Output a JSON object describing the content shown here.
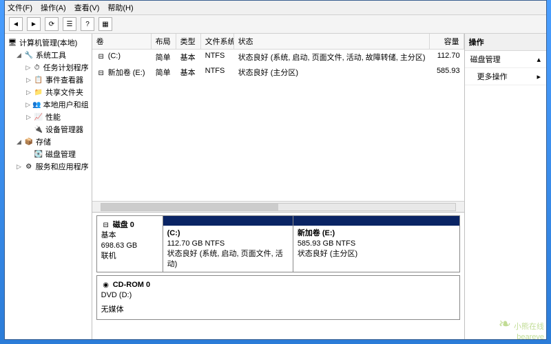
{
  "menu": {
    "file": "文件(F)",
    "action": "操作(A)",
    "view": "查看(V)",
    "help": "帮助(H)"
  },
  "tree": {
    "root": "计算机管理(本地)",
    "system_tools": "系统工具",
    "task_scheduler": "任务计划程序",
    "event_viewer": "事件查看器",
    "shared_folders": "共享文件夹",
    "local_users": "本地用户和组",
    "performance": "性能",
    "device_manager": "设备管理器",
    "storage": "存储",
    "disk_management": "磁盘管理",
    "services": "服务和应用程序"
  },
  "volumes": {
    "headers": {
      "vol": "卷",
      "layout": "布局",
      "type": "类型",
      "fs": "文件系统",
      "status": "状态",
      "capacity": "容量"
    },
    "rows": [
      {
        "vol": "(C:)",
        "layout": "简单",
        "type": "基本",
        "fs": "NTFS",
        "status": "状态良好 (系统, 启动, 页面文件, 活动, 故障转储, 主分区)",
        "capacity": "112.70"
      },
      {
        "vol": "新加卷 (E:)",
        "layout": "简单",
        "type": "基本",
        "fs": "NTFS",
        "status": "状态良好 (主分区)",
        "capacity": "585.93"
      }
    ]
  },
  "disks": {
    "disk0": {
      "name": "磁盘 0",
      "type": "基本",
      "size": "698.63 GB",
      "state": "联机"
    },
    "part_c": {
      "label": "(C:)",
      "size": "112.70 GB NTFS",
      "status": "状态良好 (系统, 启动, 页面文件, 活动)"
    },
    "part_e": {
      "label": "新加卷 (E:)",
      "size": "585.93 GB NTFS",
      "status": "状态良好 (主分区)"
    },
    "cdrom": {
      "name": "CD-ROM 0",
      "type": "DVD (D:)",
      "state": "无媒体"
    }
  },
  "actions": {
    "title": "操作",
    "disk_mgmt": "磁盘管理",
    "more": "更多操作"
  },
  "watermark": {
    "text": "小熊在线",
    "sub": "beareve"
  }
}
